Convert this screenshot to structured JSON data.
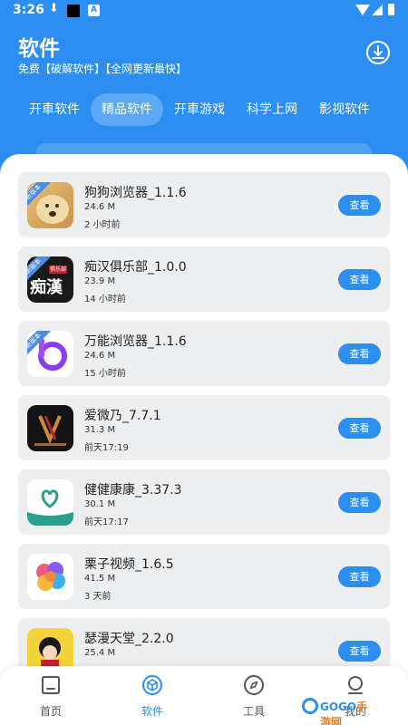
{
  "status_bar": {
    "time": "3:26"
  },
  "header": {
    "title": "软件",
    "subtitle": "免费【破解软件】【全网更新最快】"
  },
  "tabs": [
    {
      "label": "开車软件",
      "active": false
    },
    {
      "label": "精品软件",
      "active": true
    },
    {
      "label": "开車游戏",
      "active": false
    },
    {
      "label": "科学上网",
      "active": false
    },
    {
      "label": "影视软件",
      "active": false
    }
  ],
  "apps": [
    {
      "name": "狗狗浏览器_1.1.6",
      "size": "24.6 M",
      "time": "2 小时前",
      "badge": "新版本",
      "button": "查看"
    },
    {
      "name": "痴汉俱乐部_1.0.0",
      "size": "23.9 M",
      "time": "14 小时前",
      "badge": "新版本",
      "icon_text": "痴漢",
      "icon_tag": "俱乐部",
      "button": "查看"
    },
    {
      "name": "万能浏览器_1.1.6",
      "size": "24.6 M",
      "time": "15 小时前",
      "badge": "新版本",
      "button": "查看"
    },
    {
      "name": "爱微乃_7.7.1",
      "size": "31.3 M",
      "time": "前天17:19",
      "button": "查看"
    },
    {
      "name": "健健康康_3.37.3",
      "size": "30.1 M",
      "time": "前天17:17",
      "button": "查看"
    },
    {
      "name": "栗子视频_1.6.5",
      "size": "41.5 M",
      "time": "3 天前",
      "button": "查看"
    },
    {
      "name": "瑟漫天堂_2.2.0",
      "size": "25.4 M",
      "time": "",
      "button": "查看"
    }
  ],
  "bottom_nav": [
    {
      "label": "首页",
      "icon": "home-icon",
      "active": false
    },
    {
      "label": "软件",
      "icon": "cube-icon",
      "active": true
    },
    {
      "label": "工具",
      "icon": "compass-icon",
      "active": false
    },
    {
      "label": "我的",
      "icon": "profile-icon",
      "active": false
    }
  ],
  "watermark": {
    "brand": "GOGO",
    "suffix": "手游网"
  },
  "colors": {
    "primary": "#2b8ef0",
    "card_bg": "#eceef0",
    "tab_active": "#5ba9f4"
  }
}
